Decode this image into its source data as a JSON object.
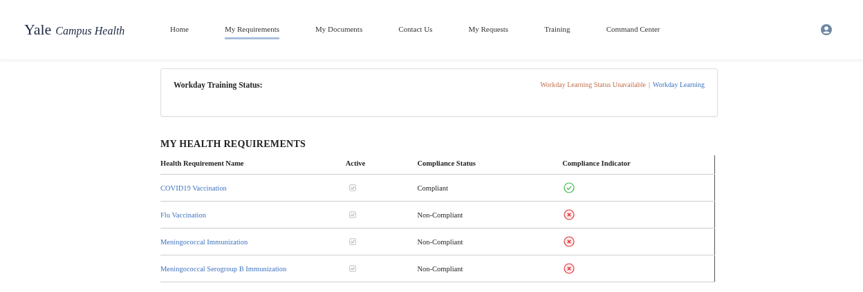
{
  "header": {
    "logo": {
      "brand": "Yale",
      "product": "Campus Health"
    },
    "nav": [
      {
        "label": "Home",
        "selected": false
      },
      {
        "label": "My Requirements",
        "selected": true
      },
      {
        "label": "My Documents",
        "selected": false
      },
      {
        "label": "Contact Us",
        "selected": false
      },
      {
        "label": "My Requests",
        "selected": false
      },
      {
        "label": "Training",
        "selected": false
      },
      {
        "label": "Command Center",
        "selected": false
      }
    ]
  },
  "training_card": {
    "label": "Workday Training Status:",
    "status": "Workday Learning Status Unavailable",
    "separator": "|",
    "link": "Workday Learning"
  },
  "requirements": {
    "title": "MY HEALTH REQUIREMENTS",
    "columns": [
      "Health Requirement Name",
      "Active",
      "Compliance Status",
      "Compliance Indicator"
    ],
    "rows": [
      {
        "name": "COVID19 Vaccination",
        "active": true,
        "status": "Compliant",
        "compliant": true
      },
      {
        "name": "Flu Vaccination",
        "active": true,
        "status": "Non-Compliant",
        "compliant": false
      },
      {
        "name": "Meningococcal Immunization",
        "active": true,
        "status": "Non-Compliant",
        "compliant": false
      },
      {
        "name": "Meningococcal Serogroup B Immunization",
        "active": true,
        "status": "Non-Compliant",
        "compliant": false
      }
    ]
  }
}
